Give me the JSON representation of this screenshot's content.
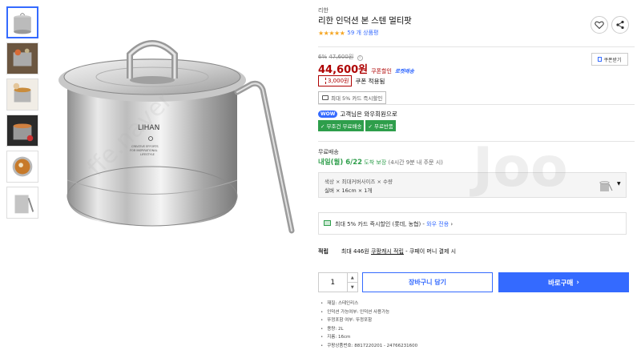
{
  "brand": "리한",
  "product": {
    "title": "리한 인덕션 본 스텐 멀티팟",
    "rating_stars": "★★★★★",
    "review_count": "59 개 상품평"
  },
  "pricing": {
    "discount_rate": "6%",
    "original_price": "47,600원",
    "info_icon": "i",
    "price": "44,600원",
    "coupon_discount_label": "쿠폰할인",
    "rocket_label": "로켓배송",
    "coupon_amount": "3,000원",
    "coupon_applied_label": "쿠폰 적용됨",
    "card_badge": "최대 5% 카드 즉시할인"
  },
  "membership": {
    "wow_badge": "WOW",
    "wow_text": "고객님은 와우회원으로",
    "tags": [
      "✓ 무조건 무료배송",
      "✓ 무료반품"
    ]
  },
  "shipping": {
    "label": "무료배송",
    "date": "내일(월) 6/22",
    "guarantee": "도착 보장",
    "note": "(4시간 9분 내 주문 시)"
  },
  "option": {
    "header": "색상 × 최대커버사이즈 × 수량",
    "value": "실버 × 16cm × 1개",
    "arrow": "▼"
  },
  "promo": {
    "text_main": "최대 5% 카드 즉시할인 (롯데, 농협) - ",
    "text_link": "와우 전용",
    "arrow": "›"
  },
  "points": {
    "label": "적립",
    "text": "최대 446원",
    "link": "쿠팡캐시 적립",
    "suffix": "- 쿠페이 머니 결제 시"
  },
  "purchase": {
    "quantity": "1",
    "qty_up": "▲",
    "qty_down": "▼",
    "cart_label": "장바구니 담기",
    "buy_label": "바로구매",
    "buy_arrow": "›"
  },
  "specs": [
    "재질: 스테인리스",
    "인덕션 가능여부: 인덕션 사용가능",
    "뚜껑포함 여부: 뚜껑포함",
    "용량: 2L",
    "지름: 16cm",
    "쿠팡상품번호: 8817220201 - 24766231600"
  ],
  "side": {
    "coupon_btn": "쿠폰받기"
  },
  "pot_labels": {
    "brand": "LIHAN",
    "line1": "CREATIVE EFFORTS",
    "line2": "FOR INSPIRATIONAL",
    "line3": "LIFESTYLE"
  },
  "watermark": "Joo",
  "watermark2": "ffe.naver",
  "colors": {
    "accent": "#346aff",
    "price": "#ae0000",
    "green": "#2e9e4b",
    "star": "#f5a623"
  },
  "icons": [
    "heart-icon",
    "share-icon",
    "coupon-download-icon",
    "card-icon",
    "info-icon",
    "chevron-down-icon",
    "chevron-right-icon"
  ]
}
